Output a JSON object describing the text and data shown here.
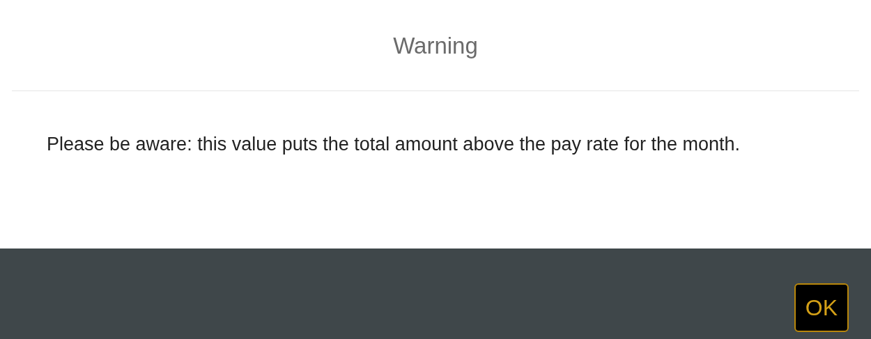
{
  "dialog": {
    "title": "Warning",
    "message": "Please be aware: this value puts the total amount above the pay rate for the month.",
    "buttons": [
      "OK"
    ]
  }
}
